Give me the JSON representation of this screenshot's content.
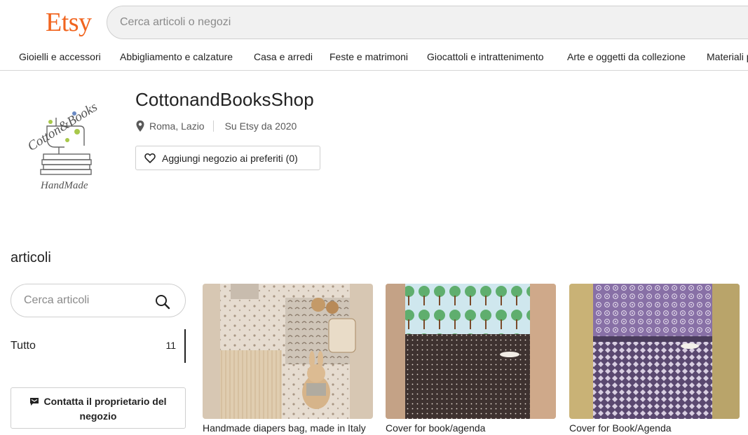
{
  "header": {
    "logo": "Etsy",
    "search_placeholder": "Cerca articoli o negozi"
  },
  "categories": [
    "Gioielli e accessori",
    "Abbigliamento e calzature",
    "Casa e arredi",
    "Feste e matrimoni",
    "Giocattoli e intrattenimento",
    "Arte e oggetti da collezione",
    "Materiali p"
  ],
  "shop": {
    "logo_text_top": "Cotton&Books",
    "logo_text_bottom": "HandMade",
    "name": "CottonandBooksShop",
    "location": "Roma, Lazio",
    "since": "Su Etsy da 2020",
    "favorite_label": "Aggiungi negozio ai preferiti (0)"
  },
  "sidebar": {
    "title": "articoli",
    "search_placeholder": "Cerca articoli",
    "category_label": "Tutto",
    "category_count": "11",
    "contact_label": "Contatta il proprietario del negozio"
  },
  "listings": [
    {
      "title": "Handmade diapers bag, made in Italy"
    },
    {
      "title": "Cover for book/agenda"
    },
    {
      "title": "Cover for Book/Agenda"
    }
  ],
  "colors": {
    "brand": "#f1641e",
    "text": "#222222",
    "muted": "#595959",
    "border": "#cfcfcf"
  }
}
